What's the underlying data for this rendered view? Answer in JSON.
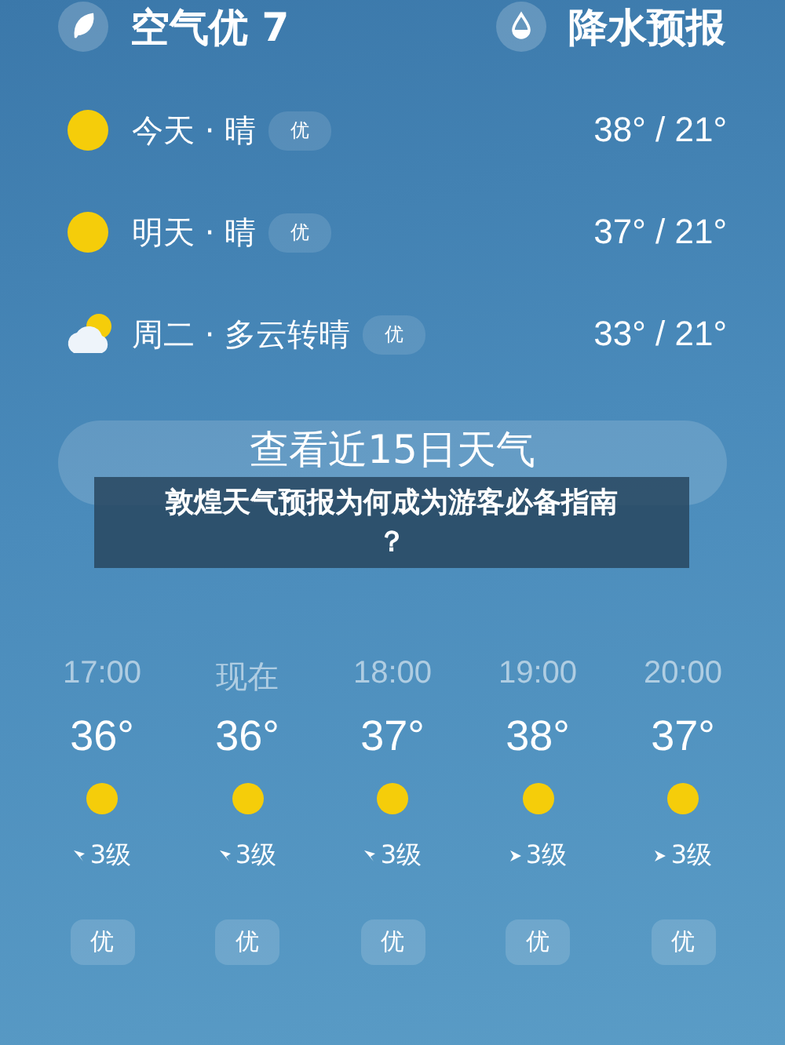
{
  "summary": [
    {
      "kind": "air",
      "label": "空气优 7"
    },
    {
      "kind": "rain",
      "label": "降水预报"
    }
  ],
  "daily": [
    {
      "day": "今天 · 晴",
      "kind": "sunny",
      "quality": "优",
      "temps": "38° / 21°"
    },
    {
      "day": "明天 · 晴",
      "kind": "sunny",
      "quality": "优",
      "temps": "37° / 21°"
    },
    {
      "day": "周二 · 多云转晴",
      "kind": "cloudy_sunny",
      "quality": "优",
      "temps": "33° / 21°"
    }
  ],
  "forecast_button": "查看近15日天气",
  "banner": {
    "title": "敦煌天气预报为何成为游客必备指南",
    "title_line_2": "？"
  },
  "hourly": [
    {
      "time": "17:00",
      "temp": "36°",
      "kind": "sunny",
      "wind": {
        "kind": "left",
        "text": "3级"
      },
      "quality": "优"
    },
    {
      "time": "现在",
      "temp": "36°",
      "kind": "sunny",
      "wind": {
        "kind": "left",
        "text": "3级"
      },
      "quality": "优"
    },
    {
      "time": "18:00",
      "temp": "37°",
      "kind": "sunny",
      "wind": {
        "kind": "left",
        "text": "3级"
      },
      "quality": "优"
    },
    {
      "time": "19:00",
      "temp": "38°",
      "kind": "sunny",
      "wind": {
        "kind": "right",
        "text": "3级"
      },
      "quality": "优"
    },
    {
      "time": "20:00",
      "temp": "37°",
      "kind": "sunny",
      "wind": {
        "kind": "right",
        "text": "3级"
      },
      "quality": "优"
    }
  ]
}
